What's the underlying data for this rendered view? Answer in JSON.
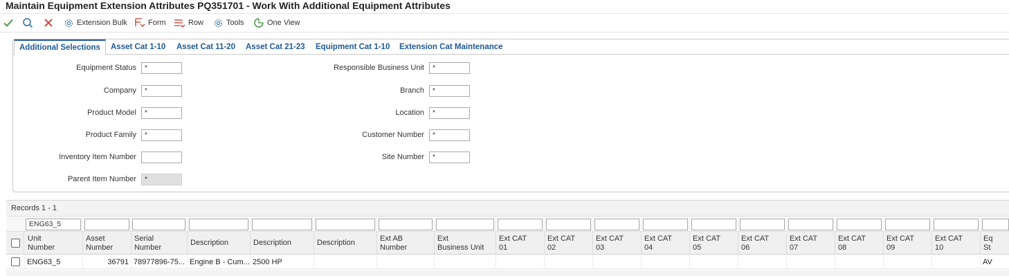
{
  "window": {
    "title": "Maintain Equipment Extension Attributes PQ351701 - Work With Additional Equipment Attributes"
  },
  "toolbar": {
    "ok_icon": "checkmark-icon",
    "find_icon": "search-icon",
    "close_icon": "close-icon",
    "buttons": [
      {
        "label": "Extension Bulk",
        "icon": "gear-icon"
      },
      {
        "label": "Form",
        "icon": "form-menu-icon"
      },
      {
        "label": "Row",
        "icon": "row-menu-icon"
      },
      {
        "label": "Tools",
        "icon": "gear-icon"
      },
      {
        "label": "One View",
        "icon": "one-view-icon"
      }
    ],
    "colors": {
      "ok": "#3a8f3a",
      "find": "#2f6fa8",
      "close": "#d32f2f",
      "accent": "#1f5a96"
    }
  },
  "tabs": [
    {
      "label": "Additional Selections",
      "active": true
    },
    {
      "label": "Asset Cat 1-10",
      "active": false
    },
    {
      "label": "Asset Cat 11-20",
      "active": false
    },
    {
      "label": "Asset Cat 21-23",
      "active": false
    },
    {
      "label": "Equipment Cat 1-10",
      "active": false
    },
    {
      "label": "Extension Cat Maintenance",
      "active": false
    }
  ],
  "filters": {
    "left": [
      {
        "label": "Equipment Status",
        "value": "*",
        "disabled": false
      },
      {
        "label": "Company",
        "value": "*",
        "disabled": false
      },
      {
        "label": "Product Model",
        "value": "*",
        "disabled": false
      },
      {
        "label": "Product Family",
        "value": "*",
        "disabled": false
      },
      {
        "label": "Inventory Item Number",
        "value": "",
        "disabled": false
      },
      {
        "label": "Parent Item Number",
        "value": "*",
        "disabled": true
      }
    ],
    "right": [
      {
        "label": "Responsible Business Unit",
        "value": "*"
      },
      {
        "label": "Branch",
        "value": "*"
      },
      {
        "label": "Location",
        "value": "*"
      },
      {
        "label": "Customer Number",
        "value": "*"
      },
      {
        "label": "Site Number",
        "value": "*"
      }
    ]
  },
  "grid": {
    "records_label": "Records 1 - 1",
    "columns": [
      {
        "line1": "Unit",
        "line2": "Number",
        "qbe": "ENG63_5"
      },
      {
        "line1": "Asset",
        "line2": "Number",
        "qbe": ""
      },
      {
        "line1": "Serial",
        "line2": "Number",
        "qbe": ""
      },
      {
        "line1": "Description",
        "line2": "",
        "qbe": ""
      },
      {
        "line1": "Description",
        "line2": "",
        "qbe": ""
      },
      {
        "line1": "Description",
        "line2": "",
        "qbe": ""
      },
      {
        "line1": "Ext AB",
        "line2": "Number",
        "qbe": ""
      },
      {
        "line1": "Ext",
        "line2": "Business Unit",
        "qbe": ""
      },
      {
        "line1": "Ext CAT",
        "line2": "01",
        "qbe": ""
      },
      {
        "line1": "Ext CAT",
        "line2": "02",
        "qbe": ""
      },
      {
        "line1": "Ext CAT",
        "line2": "03",
        "qbe": ""
      },
      {
        "line1": "Ext CAT",
        "line2": "04",
        "qbe": ""
      },
      {
        "line1": "Ext CAT",
        "line2": "05",
        "qbe": ""
      },
      {
        "line1": "Ext CAT",
        "line2": "06",
        "qbe": ""
      },
      {
        "line1": "Ext CAT",
        "line2": "07",
        "qbe": ""
      },
      {
        "line1": "Ext CAT",
        "line2": "08",
        "qbe": ""
      },
      {
        "line1": "Ext CAT",
        "line2": "09",
        "qbe": ""
      },
      {
        "line1": "Ext CAT",
        "line2": "10",
        "qbe": ""
      },
      {
        "line1": "Eq",
        "line2": "St",
        "qbe": ""
      }
    ],
    "rows": [
      [
        "ENG63_5",
        "36791",
        "78977896-75...",
        "Engine B - Cum...",
        "2500 HP",
        "",
        "",
        "",
        "",
        "",
        "",
        "",
        "",
        "",
        "",
        "",
        "",
        "",
        "AV"
      ]
    ]
  }
}
